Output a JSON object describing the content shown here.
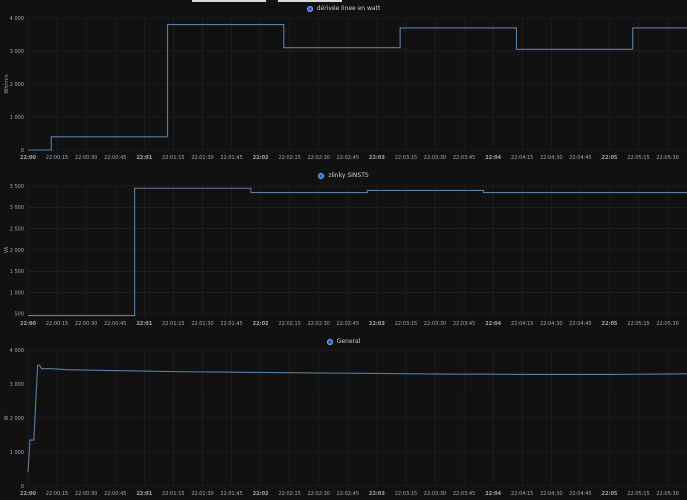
{
  "chart_data": [
    {
      "type": "line",
      "step": true,
      "legend": "dérivée linee en watt",
      "ylabel": "Wh/min",
      "ylim": [
        0,
        4000
      ],
      "yticks": [
        0,
        1000,
        2000,
        3000,
        4000
      ],
      "ytick_labels": [
        "0",
        "1 000",
        "2 000",
        "3 000",
        "4 000"
      ],
      "grid": true,
      "color": "#5b7fa6",
      "series": [
        {
          "x": [
            "22:00:00",
            "22:00:12",
            "22:01:12",
            "22:02:12",
            "22:03:12",
            "22:04:12",
            "22:05:12",
            "22:05:40"
          ],
          "values": [
            0,
            400,
            3800,
            3100,
            3700,
            3050,
            3700,
            3700
          ]
        }
      ]
    },
    {
      "type": "line",
      "step": true,
      "legend": "zlinky SINSTS",
      "ylabel": "VA",
      "ylim": [
        450,
        3550
      ],
      "yticks": [
        500,
        1000,
        1500,
        2000,
        2500,
        3000,
        3500
      ],
      "ytick_labels": [
        "500",
        "1 000",
        "1 500",
        "2 000",
        "2 500",
        "3 000",
        "3 500"
      ],
      "grid": true,
      "color": "#5b7fa6",
      "series": [
        {
          "x": [
            "22:00:00",
            "22:00:55",
            "22:01:55",
            "22:02:55",
            "22:03:55",
            "22:05:40"
          ],
          "values": [
            460,
            3450,
            3350,
            3400,
            3350,
            3350
          ]
        }
      ]
    },
    {
      "type": "line",
      "step": false,
      "legend": "General",
      "ylabel": "W",
      "ylim": [
        0,
        4000
      ],
      "yticks": [
        0,
        1000,
        2000,
        3000,
        4000
      ],
      "ytick_labels": [
        "0",
        "1 000",
        "2 000",
        "3 000",
        "4 000"
      ],
      "grid": true,
      "color": "#5b7fa6",
      "series": [
        {
          "x": [
            "22:00:00",
            "22:00:01",
            "22:00:03",
            "22:00:05",
            "22:00:06",
            "22:00:07",
            "22:00:09",
            "22:00:12",
            "22:00:20",
            "22:00:40",
            "22:01:00",
            "22:01:20",
            "22:01:40",
            "22:02:00",
            "22:02:20",
            "22:02:40",
            "22:03:00",
            "22:03:20",
            "22:03:40",
            "22:04:00",
            "22:04:20",
            "22:04:40",
            "22:05:00",
            "22:05:20",
            "22:05:40"
          ],
          "values": [
            400,
            1350,
            1350,
            3550,
            3550,
            3450,
            3450,
            3450,
            3420,
            3400,
            3380,
            3360,
            3350,
            3340,
            3330,
            3320,
            3310,
            3300,
            3290,
            3290,
            3280,
            3280,
            3280,
            3290,
            3300
          ]
        }
      ]
    }
  ],
  "x_axis": {
    "range": [
      "22:00:00",
      "22:05:40"
    ],
    "ticks": [
      {
        "t": "22:00:00",
        "label": "22:00",
        "bold": true
      },
      {
        "t": "22:00:15",
        "label": "22:00:15",
        "bold": false
      },
      {
        "t": "22:00:30",
        "label": "22:00:30",
        "bold": false
      },
      {
        "t": "22:00:45",
        "label": "22:00:45",
        "bold": false
      },
      {
        "t": "22:01:00",
        "label": "22:01",
        "bold": true
      },
      {
        "t": "22:01:15",
        "label": "22:01:15",
        "bold": false
      },
      {
        "t": "22:01:30",
        "label": "22:01:30",
        "bold": false
      },
      {
        "t": "22:01:45",
        "label": "22:01:45",
        "bold": false
      },
      {
        "t": "22:02:00",
        "label": "22:02",
        "bold": true
      },
      {
        "t": "22:02:15",
        "label": "22:02:15",
        "bold": false
      },
      {
        "t": "22:02:30",
        "label": "22:02:30",
        "bold": false
      },
      {
        "t": "22:02:45",
        "label": "22:02:45",
        "bold": false
      },
      {
        "t": "22:03:00",
        "label": "22:03",
        "bold": true
      },
      {
        "t": "22:03:15",
        "label": "22:03:15",
        "bold": false
      },
      {
        "t": "22:03:30",
        "label": "22:03:30",
        "bold": false
      },
      {
        "t": "22:03:45",
        "label": "22:03:45",
        "bold": false
      },
      {
        "t": "22:04:00",
        "label": "22:04",
        "bold": true
      },
      {
        "t": "22:04:15",
        "label": "22:04:15",
        "bold": false
      },
      {
        "t": "22:04:30",
        "label": "22:04:30",
        "bold": false
      },
      {
        "t": "22:04:45",
        "label": "22:04:45",
        "bold": false
      },
      {
        "t": "22:05:00",
        "label": "22:05",
        "bold": true
      },
      {
        "t": "22:05:15",
        "label": "22:05:15",
        "bold": false
      },
      {
        "t": "22:05:30",
        "label": "22:05:30",
        "bold": false
      }
    ]
  },
  "colors": {
    "background": "#111111",
    "grid": "#262626",
    "tick_text": "#9fa7b3",
    "legend_text": "#c7d0d9",
    "swatch": "#1f60c4"
  }
}
